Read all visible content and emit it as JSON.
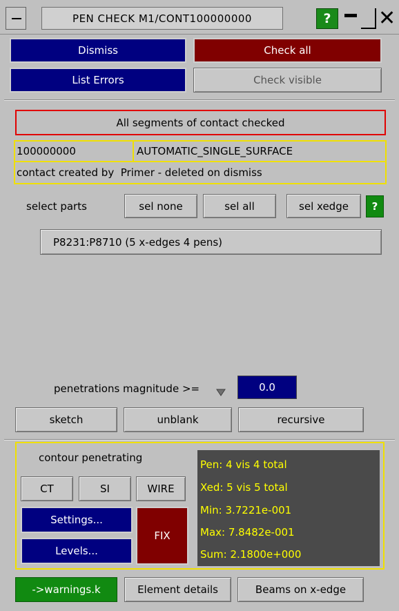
{
  "window": {
    "title": "PEN CHECK M1/CONT100000000",
    "help_label": "?"
  },
  "top_buttons": {
    "dismiss": "Dismiss",
    "check_all": "Check all",
    "list_errors": "List Errors",
    "check_visible": "Check visible"
  },
  "status": {
    "message": "All segments of contact checked"
  },
  "contact": {
    "id": "100000000",
    "type": "AUTOMATIC_SINGLE_SURFACE",
    "note": "contact created by  Primer - deleted on dismiss"
  },
  "select_parts": {
    "label": "select parts",
    "sel_none": "sel none",
    "sel_all": "sel all",
    "sel_xedge": "sel xedge",
    "help": "?"
  },
  "parts_list": [
    "P8231:P8710 (5 x-edges 4 pens)"
  ],
  "penetrations": {
    "label": "penetrations magnitude >=",
    "value": "0.0"
  },
  "actions": {
    "sketch": "sketch",
    "unblank": "unblank",
    "recursive": "recursive"
  },
  "contour": {
    "title": "contour penetrating",
    "ct": "CT",
    "si": "SI",
    "wire": "WIRE",
    "settings": "Settings...",
    "levels": "Levels...",
    "fix": "FIX"
  },
  "stats": {
    "pen": "Pen: 4 vis 4 total",
    "xed": "Xed: 5 vis 5 total",
    "min": "Min:  3.7221e-001",
    "max": "Max:  7.8482e-001",
    "sum": "Sum:  2.1800e+000"
  },
  "bottom_buttons": {
    "warnings": "->warnings.k",
    "element_details": "Element details",
    "beams": "Beams on x-edge"
  },
  "colors": {
    "navy": "#000080",
    "maroon": "#800000",
    "green": "#118a11",
    "yellow": "#f0e000",
    "stats_bg": "#4a4a4a"
  }
}
